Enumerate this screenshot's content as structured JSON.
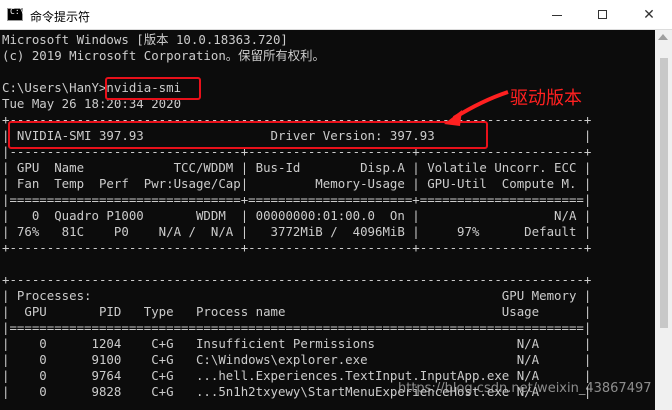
{
  "window": {
    "title": "命令提示符",
    "icon": "terminal-icon",
    "controls": {
      "minimize": "minimize-icon",
      "maximize": "maximize-icon",
      "close": "close-icon",
      "close_glyph": "✕"
    }
  },
  "console": {
    "lines": [
      "Microsoft Windows [版本 10.0.18363.720]",
      "(c) 2019 Microsoft Corporation。保留所有权利。",
      "",
      "C:\\Users\\HanY>nvidia-smi",
      "Tue May 26 18:20:34 2020",
      "+-----------------------------------------------------------------------------+",
      "| NVIDIA-SMI 397.93                 Driver Version: 397.93                    |",
      "|-------------------------------+----------------------+----------------------+",
      "| GPU  Name            TCC/WDDM | Bus-Id        Disp.A | Volatile Uncorr. ECC |",
      "| Fan  Temp  Perf  Pwr:Usage/Cap|         Memory-Usage | GPU-Util  Compute M. |",
      "|===============================+======================+======================|",
      "|   0  Quadro P1000       WDDM  | 00000000:01:00.0  On |                  N/A |",
      "| 76%   81C    P0    N/A /  N/A |   3772MiB /  4096MiB |     97%      Default |",
      "+-------------------------------+----------------------+----------------------+",
      "",
      "+-----------------------------------------------------------------------------+",
      "| Processes:                                                       GPU Memory |",
      "|  GPU       PID   Type   Process name                             Usage      |",
      "|=============================================================================|",
      "|    0      1204    C+G   Insufficient Permissions                   N/A      |",
      "|    0      9100    C+G   C:\\Windows\\explorer.exe                    N/A      |",
      "|    0      9764    C+G   ...hell.Experiences.TextInput.InputApp.exe N/A      |",
      "|    0      9828    C+G   ...5n1h2txyewy\\StartMenuExperienceHost.exe N/A      |"
    ]
  },
  "annotation": {
    "label": "驱动版本",
    "color": "#ff2020"
  },
  "watermark": "https://blog.csdn.net/weixin_43867497",
  "colors": {
    "console_bg": "#0c0c0c",
    "console_text": "#cccccc",
    "highlight": "#e8101a"
  }
}
